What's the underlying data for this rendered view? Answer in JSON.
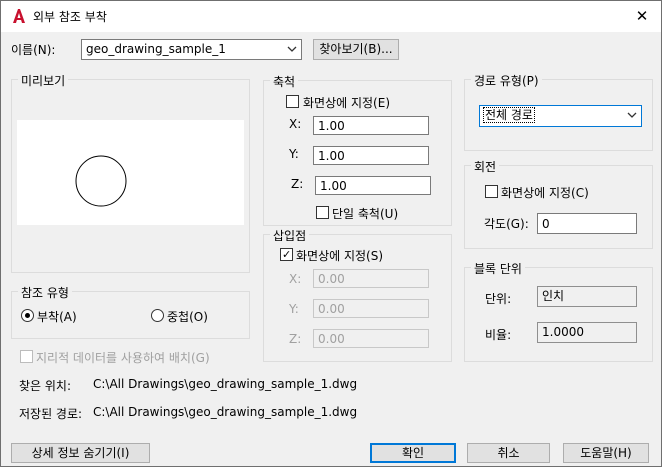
{
  "window": {
    "title": "외부 참조 부착",
    "close_glyph": "✕"
  },
  "name_row": {
    "label": "이름(N):",
    "value": "geo_drawing_sample_1",
    "browse_label": "찾아보기(B)..."
  },
  "preview": {
    "title": "미리보기"
  },
  "scale": {
    "title": "축척",
    "specify_on_screen": "화면상에 지정(E)",
    "x_label": "X:",
    "x_value": "1.00",
    "y_label": "Y:",
    "y_value": "1.00",
    "z_label": "Z:",
    "z_value": "1.00",
    "uniform": "단일 축척(U)"
  },
  "insertion": {
    "title": "삽입점",
    "specify_on_screen": "화면상에 지정(S)",
    "x_label": "X:",
    "x_value": "0.00",
    "y_label": "Y:",
    "y_value": "0.00",
    "z_label": "Z:",
    "z_value": "0.00"
  },
  "path_type": {
    "title": "경로 유형(P)",
    "value": "전체 경로"
  },
  "rotation": {
    "title": "회전",
    "specify_on_screen": "화면상에 지정(C)",
    "angle_label": "각도(G):",
    "angle_value": "0"
  },
  "block_unit": {
    "title": "블록 단위",
    "unit_label": "단위:",
    "unit_value": "인치",
    "factor_label": "비율:",
    "factor_value": "1.0000"
  },
  "reference_type": {
    "title": "참조 유형",
    "attachment": "부착(A)",
    "overlay": "중첩(O)"
  },
  "geo": {
    "label": "지리적 데이터를 사용하여 배치(G)"
  },
  "found_in": {
    "label": "찾은 위치:",
    "value": "C:\\All Drawings\\geo_drawing_sample_1.dwg"
  },
  "saved_path": {
    "label": "저장된 경로:",
    "value": "C:\\All Drawings\\geo_drawing_sample_1.dwg"
  },
  "buttons": {
    "hide_details": "상세 정보 숨기기(I)",
    "ok": "확인",
    "cancel": "취소",
    "help": "도움말(H)"
  },
  "colors": {
    "accent": "#0078d7",
    "icon_red": "#c8102e"
  }
}
